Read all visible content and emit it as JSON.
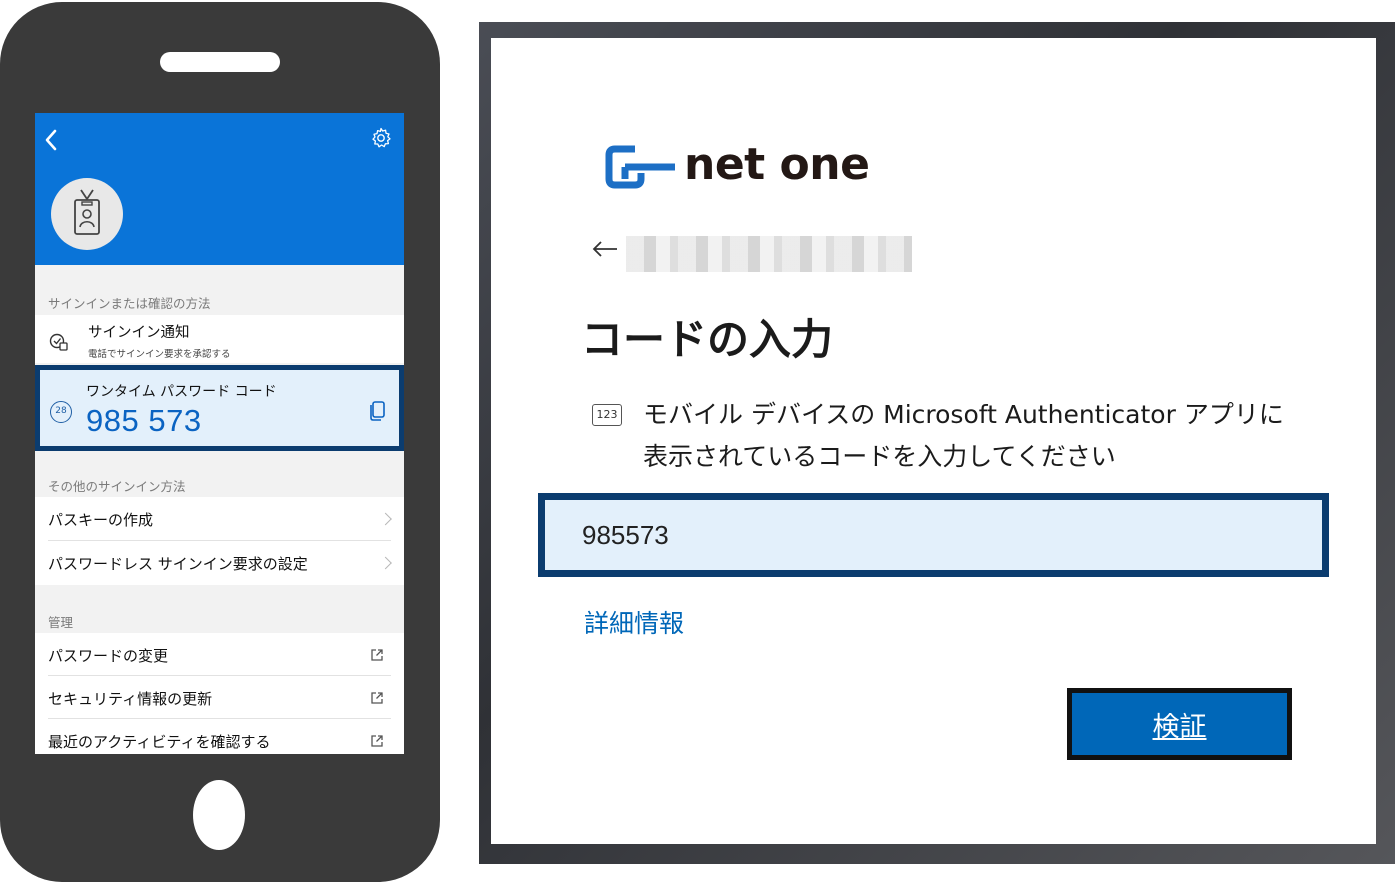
{
  "phone_app": {
    "sections": {
      "signin_methods": "サインインまたは確認の方法",
      "other_methods": "その他のサインイン方法",
      "management": "管理"
    },
    "notification_item": {
      "title": "サインイン通知",
      "subtitle": "電話でサインイン要求を承認する"
    },
    "otp_item": {
      "title": "ワンタイム パスワード コード",
      "code": "985 573",
      "timer": "28"
    },
    "other_items": [
      "パスキーの作成",
      "パスワードレス サインイン要求の設定"
    ],
    "management_items": [
      "パスワードの変更",
      "セキュリティ情報の更新",
      "最近のアクティビティを確認する"
    ],
    "colors": {
      "header": "#0a74d8",
      "highlight_border": "#0b3c6f",
      "highlight_fill": "#e3f0fb"
    }
  },
  "dialog": {
    "logo_text": "net one",
    "title": "コードの入力",
    "instruction_line1": "モバイル デバイスの Microsoft Authenticator アプリに",
    "instruction_line2": "表示されているコードを入力してください",
    "number_icon_label": "123",
    "code_value": "985573",
    "more_info_link": "詳細情報",
    "verify_button": "検証",
    "colors": {
      "accent": "#0067b8"
    }
  }
}
